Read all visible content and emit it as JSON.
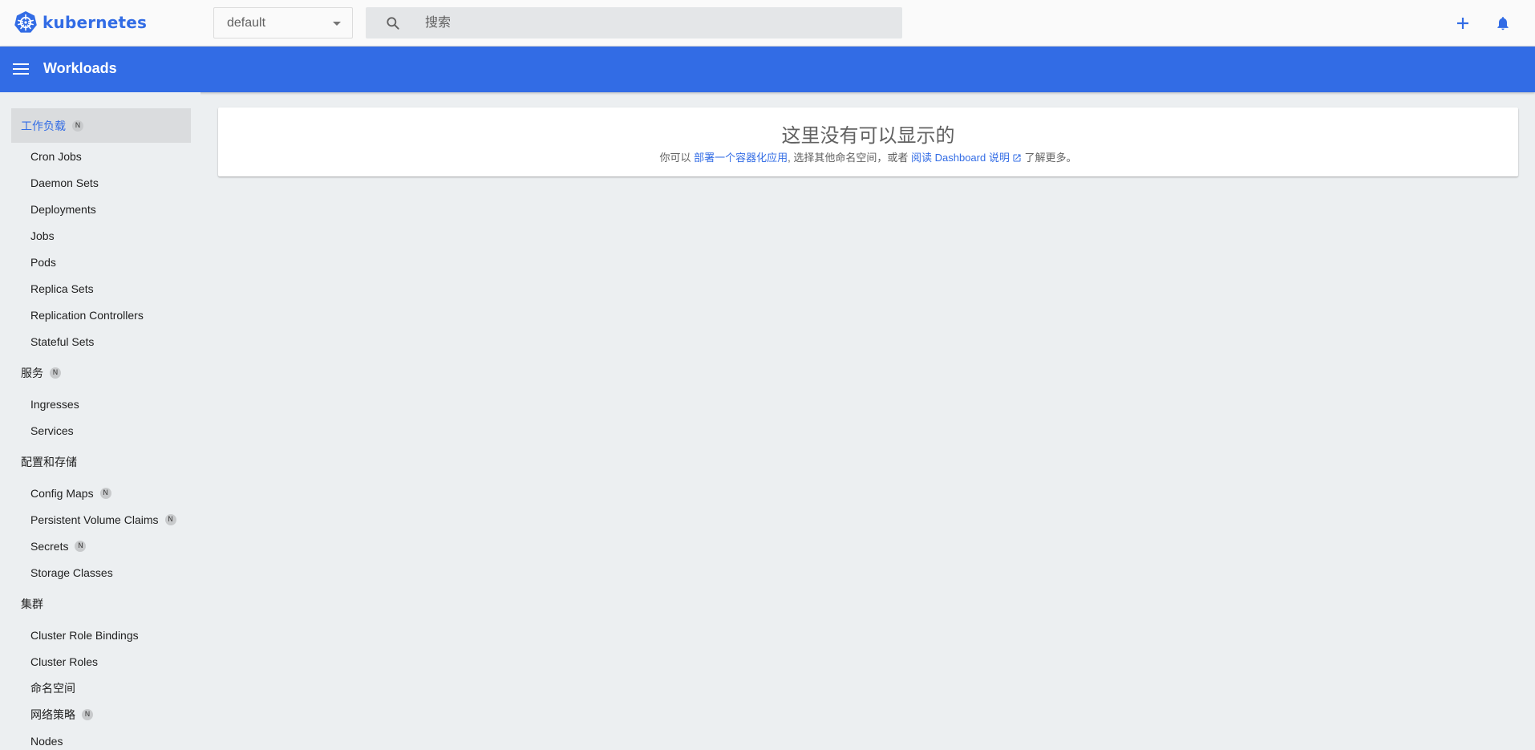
{
  "topbar": {
    "logo_text": "kubernetes",
    "logo_icon": "kubernetes-helm-icon",
    "namespace": "default",
    "search_placeholder": "搜索",
    "search_icon": "search-icon",
    "create_icon": "plus-icon",
    "notifications_icon": "bell-icon"
  },
  "appbar": {
    "title": "Workloads",
    "menu_icon": "hamburger-menu-icon"
  },
  "sidebar": {
    "workloads": {
      "label": "工作负载",
      "badge": "N",
      "items": [
        "Cron Jobs",
        "Daemon Sets",
        "Deployments",
        "Jobs",
        "Pods",
        "Replica Sets",
        "Replication Controllers",
        "Stateful Sets"
      ]
    },
    "services": {
      "label": "服务",
      "badge": "N",
      "items": [
        "Ingresses",
        "Services"
      ]
    },
    "config": {
      "label": "配置和存储",
      "items": [
        {
          "label": "Config Maps",
          "badge": "N"
        },
        {
          "label": "Persistent Volume Claims",
          "badge": "N"
        },
        {
          "label": "Secrets",
          "badge": "N"
        },
        {
          "label": "Storage Classes"
        }
      ]
    },
    "cluster": {
      "label": "集群",
      "items": [
        {
          "label": "Cluster Role Bindings"
        },
        {
          "label": "Cluster Roles"
        },
        {
          "label": "命名空间"
        },
        {
          "label": "网络策略",
          "badge": "N"
        },
        {
          "label": "Nodes"
        }
      ]
    }
  },
  "main": {
    "empty_title": "这里没有可以显示的",
    "desc_prefix": "你可以",
    "deploy_link": "部署一个容器化应用",
    "desc_middle": ", 选择其他命名空间，或者",
    "docs_link": "阅读 Dashboard 说明",
    "desc_suffix": "了解更多。"
  },
  "colors": {
    "brand": "#326ce5",
    "background": "#eceff1",
    "active_item_bg": "#dadcde"
  }
}
